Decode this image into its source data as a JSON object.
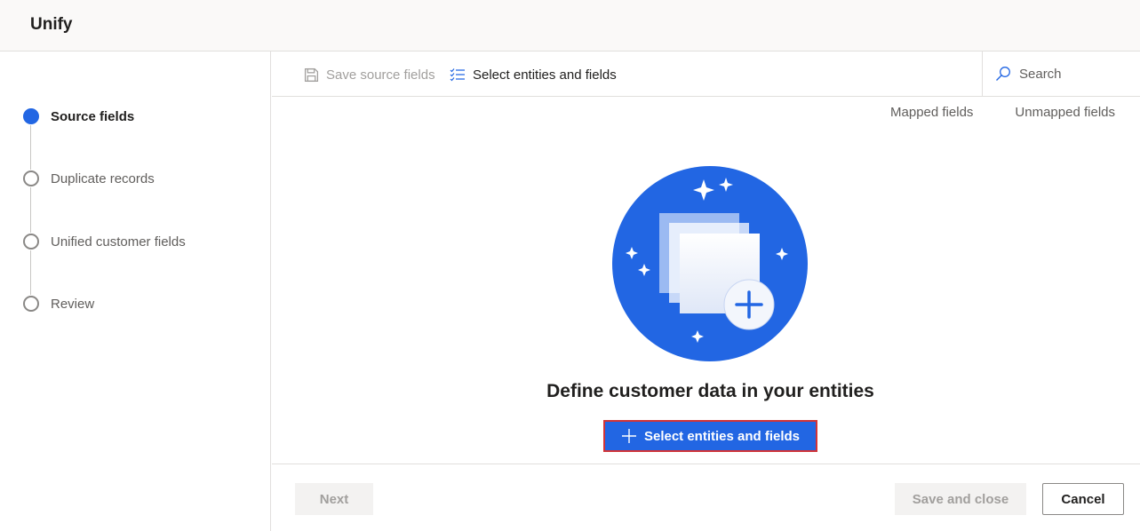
{
  "header": {
    "title": "Unify"
  },
  "steps": [
    {
      "label": "Source fields",
      "active": true
    },
    {
      "label": "Duplicate records",
      "active": false
    },
    {
      "label": "Unified customer fields",
      "active": false
    },
    {
      "label": "Review",
      "active": false
    }
  ],
  "toolbar": {
    "save_label": "Save source fields",
    "save_icon": "save-icon",
    "select_label": "Select entities and fields",
    "select_icon": "checklist-icon"
  },
  "search": {
    "placeholder": "Search",
    "icon": "search-icon"
  },
  "tabs": {
    "mapped": "Mapped fields",
    "unmapped": "Unmapped fields"
  },
  "empty_state": {
    "title": "Define customer data in your entities",
    "button_label": "Select entities and fields",
    "button_icon": "plus-icon"
  },
  "footer": {
    "next_label": "Next",
    "save_close_label": "Save and close",
    "cancel_label": "Cancel"
  },
  "colors": {
    "accent": "#2266e3",
    "highlight_border": "#d13438"
  }
}
